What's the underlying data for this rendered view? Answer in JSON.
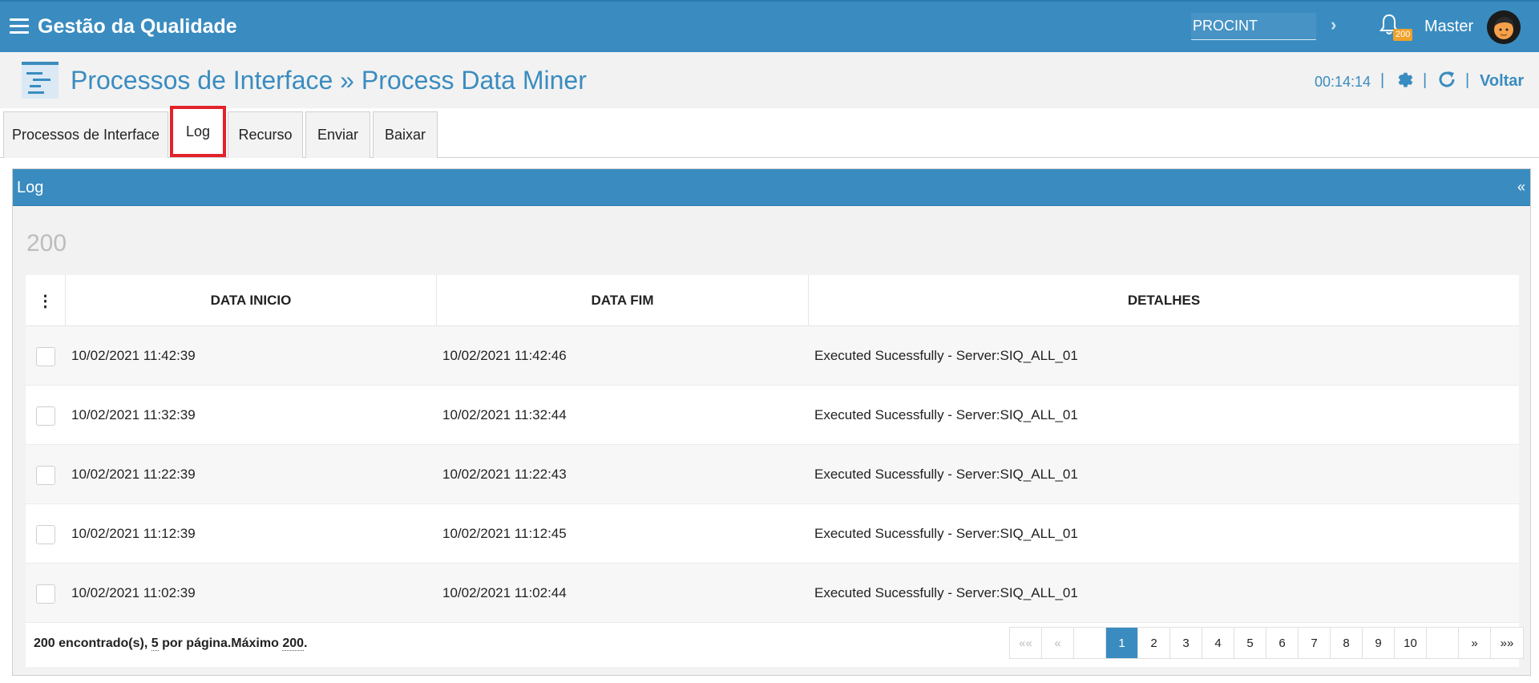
{
  "header": {
    "app_title": "Gestão da Qualidade",
    "context_value": "PROCINT",
    "notification_count": "200",
    "user_name": "Master",
    "colors": {
      "primary": "#3a8cc0",
      "badge": "#f0a22a",
      "tab_highlight": "#e3222a"
    }
  },
  "titlebar": {
    "title": "Processos de Interface » Process Data Miner",
    "timer": "00:14:14",
    "back_label": "Voltar"
  },
  "tabs": [
    {
      "label": "Processos de Interface"
    },
    {
      "label": "Log",
      "active": true
    },
    {
      "label": "Recurso"
    },
    {
      "label": "Enviar"
    },
    {
      "label": "Baixar"
    }
  ],
  "panel": {
    "title": "Log",
    "collapse_glyph": "«",
    "count": "200",
    "columns": {
      "menu": "⋮",
      "start": "DATA INICIO",
      "end": "DATA FIM",
      "details": "DETALHES"
    },
    "rows": [
      {
        "start": "10/02/2021 11:42:39",
        "end": "10/02/2021 11:42:46",
        "details": "Executed Sucessfully - Server:SIQ_ALL_01"
      },
      {
        "start": "10/02/2021 11:32:39",
        "end": "10/02/2021 11:32:44",
        "details": "Executed Sucessfully - Server:SIQ_ALL_01"
      },
      {
        "start": "10/02/2021 11:22:39",
        "end": "10/02/2021 11:22:43",
        "details": "Executed Sucessfully - Server:SIQ_ALL_01"
      },
      {
        "start": "10/02/2021 11:12:39",
        "end": "10/02/2021 11:12:45",
        "details": "Executed Sucessfully - Server:SIQ_ALL_01"
      },
      {
        "start": "10/02/2021 11:02:39",
        "end": "10/02/2021 11:02:44",
        "details": "Executed Sucessfully - Server:SIQ_ALL_01"
      }
    ],
    "footer": {
      "found": "200",
      "found_text": " encontrado(s), ",
      "per_page": "5",
      "per_page_text": " por página.Máximo ",
      "max": "200",
      "end_text": "."
    },
    "pager": {
      "first": "««",
      "prev": "«",
      "pages": [
        "1",
        "2",
        "3",
        "4",
        "5",
        "6",
        "7",
        "8",
        "9",
        "10"
      ],
      "current_page": "1",
      "next": "»",
      "last": "»»"
    }
  }
}
